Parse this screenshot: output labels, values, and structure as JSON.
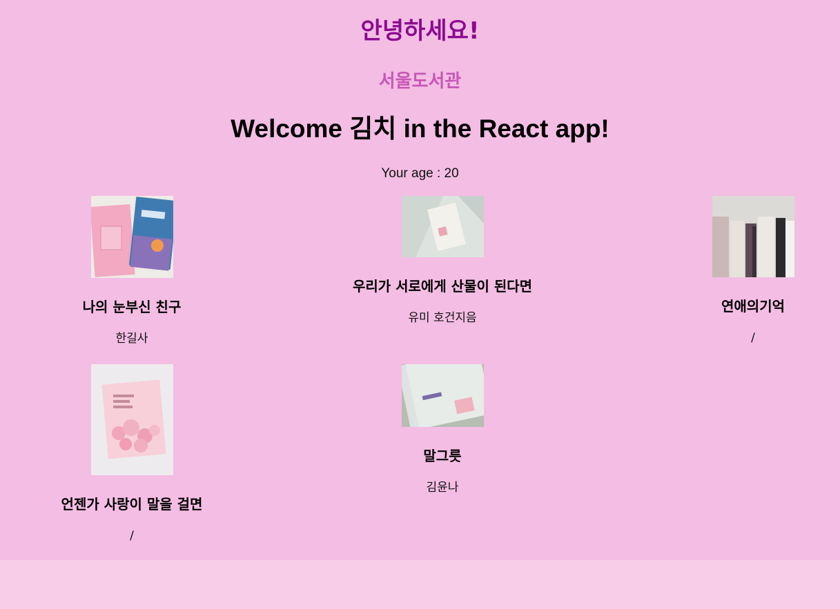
{
  "header": {
    "greeting": "안녕하세요!",
    "library_name": "서울도서관",
    "welcome": "Welcome 김치 in the React app!",
    "age_text": "Your age : 20"
  },
  "books": [
    {
      "title": "나의 눈부신 친구",
      "author": "한길사",
      "cover_icon": "book-cover-photo"
    },
    {
      "title": "우리가 서로에게 산물이 된다면",
      "author": "유미 호건지음",
      "cover_icon": "book-cover-photo"
    },
    {
      "title": "연애의기억",
      "author": "/",
      "cover_icon": "book-cover-photo"
    },
    {
      "title": "언젠가 사랑이 말을 걸면",
      "author": "/",
      "cover_icon": "book-cover-photo"
    },
    {
      "title": "말그릇",
      "author": "김윤나",
      "cover_icon": "book-cover-photo"
    }
  ],
  "colors": {
    "background": "#f4bde4",
    "footer_background": "#f8cde8",
    "greeting": "#8b0a8f",
    "library_name": "#c757b6"
  }
}
